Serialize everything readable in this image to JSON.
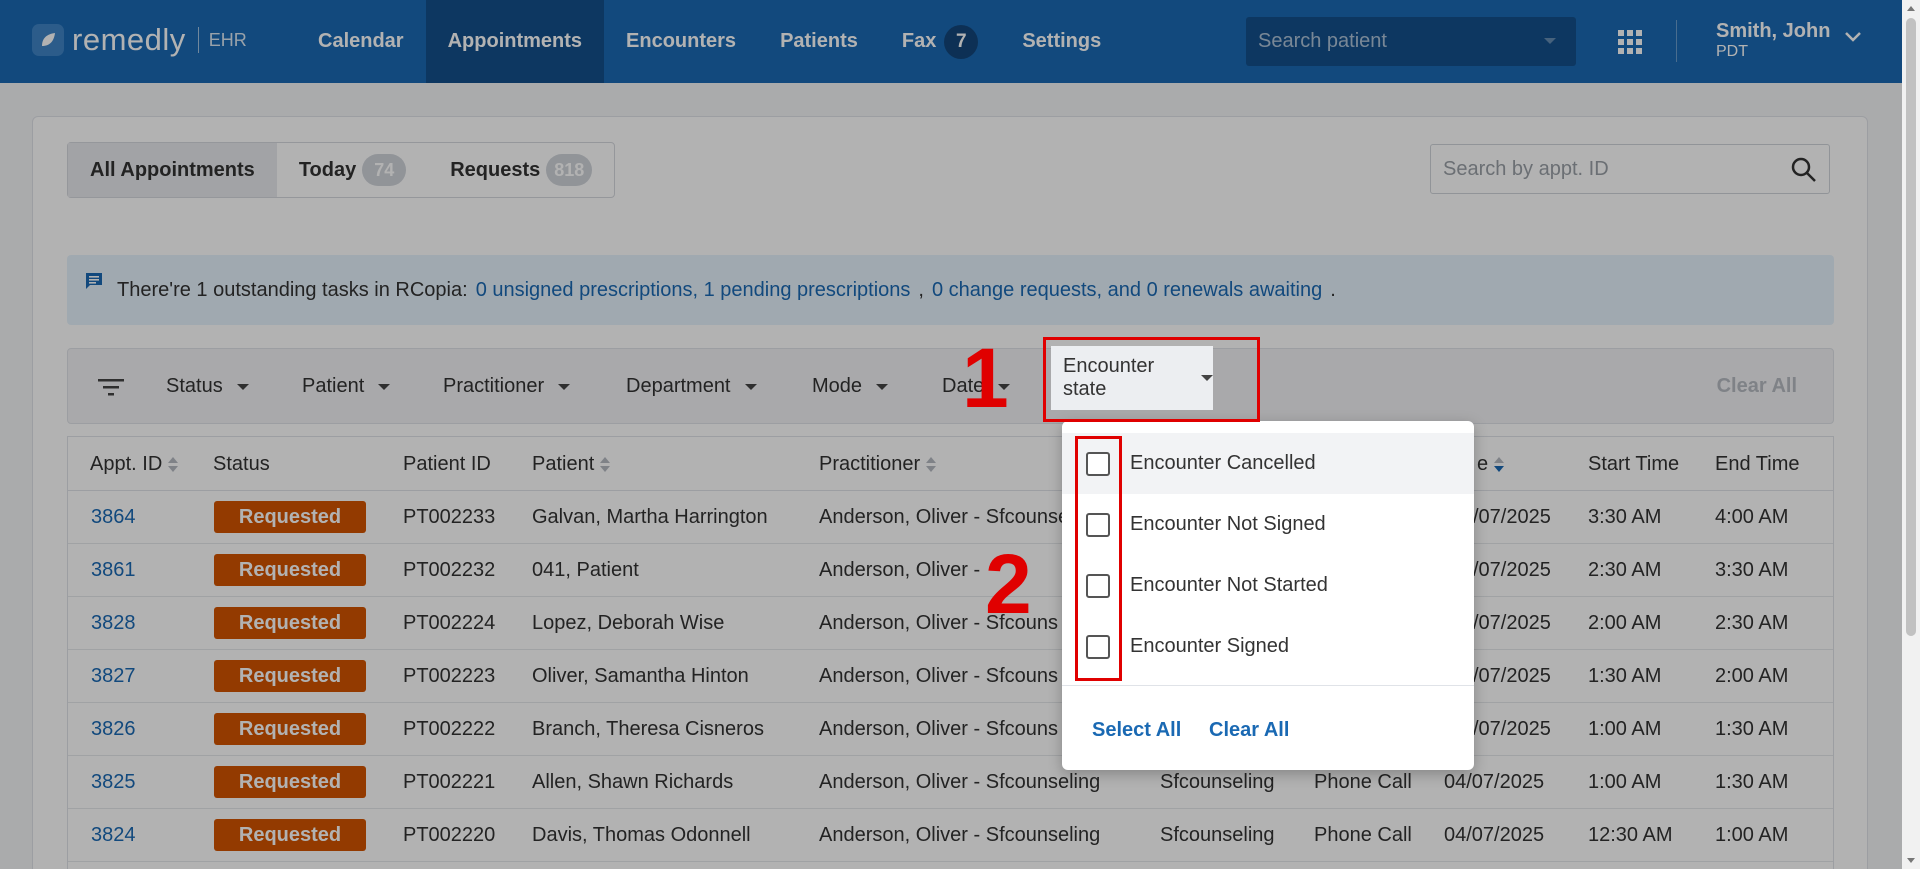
{
  "header": {
    "logo_text": "remedly",
    "logo_sub": "EHR",
    "nav": [
      {
        "label": "Calendar"
      },
      {
        "label": "Appointments"
      },
      {
        "label": "Encounters"
      },
      {
        "label": "Patients"
      },
      {
        "label": "Fax",
        "badge": "7"
      },
      {
        "label": "Settings"
      }
    ],
    "search_placeholder": "Search patient",
    "user_name": "Smith, John",
    "user_tz": "PDT"
  },
  "tabs": [
    {
      "label": "All Appointments"
    },
    {
      "label": "Today",
      "badge": "74"
    },
    {
      "label": "Requests",
      "badge": "818"
    }
  ],
  "appt_search_placeholder": "Search by appt. ID",
  "alert": {
    "text": "There're 1 outstanding tasks in RCopia:",
    "link1": "0 unsigned prescriptions, 1 pending prescriptions",
    "sep": ",",
    "link2": "0 change requests, and 0 renewals awaiting",
    "end": "."
  },
  "filters": {
    "status": "Status",
    "patient": "Patient",
    "practitioner": "Practitioner",
    "department": "Department",
    "mode": "Mode",
    "date": "Date",
    "encounter_state": "Encounter state",
    "clear_all": "Clear All"
  },
  "table": {
    "columns": [
      "Appt. ID",
      "Status",
      "Patient ID",
      "Patient",
      "Practitioner",
      "e",
      "Start Time",
      "End Time"
    ],
    "rows": [
      {
        "id": "3864",
        "status": "Requested",
        "pid": "PT002233",
        "patient": "Galvan, Martha Harrington",
        "practitioner": "Anderson, Oliver - Sfcounse",
        "dept": "",
        "mode": "",
        "date": "/07/2025",
        "start": "3:30 AM",
        "end": "4:00 AM"
      },
      {
        "id": "3861",
        "status": "Requested",
        "pid": "PT002232",
        "patient": "041, Patient",
        "practitioner": "Anderson, Oliver -",
        "dept": "",
        "mode": "",
        "date": "/07/2025",
        "start": "2:30 AM",
        "end": "3:30 AM"
      },
      {
        "id": "3828",
        "status": "Requested",
        "pid": "PT002224",
        "patient": "Lopez, Deborah Wise",
        "practitioner": "Anderson, Oliver - Sfcouns",
        "dept": "",
        "mode": "",
        "date": "/07/2025",
        "start": "2:00 AM",
        "end": "2:30 AM"
      },
      {
        "id": "3827",
        "status": "Requested",
        "pid": "PT002223",
        "patient": "Oliver, Samantha Hinton",
        "practitioner": "Anderson, Oliver - Sfcouns",
        "dept": "",
        "mode": "",
        "date": "/07/2025",
        "start": "1:30 AM",
        "end": "2:00 AM"
      },
      {
        "id": "3826",
        "status": "Requested",
        "pid": "PT002222",
        "patient": "Branch, Theresa Cisneros",
        "practitioner": "Anderson, Oliver - Sfcouns",
        "dept": "",
        "mode": "",
        "date": "/07/2025",
        "start": "1:00 AM",
        "end": "1:30 AM"
      },
      {
        "id": "3825",
        "status": "Requested",
        "pid": "PT002221",
        "patient": "Allen, Shawn Richards",
        "practitioner": "Anderson, Oliver - Sfcounseling",
        "dept": "Sfcounseling",
        "mode": "Phone Call",
        "date": "04/07/2025",
        "start": "1:00 AM",
        "end": "1:30 AM"
      },
      {
        "id": "3824",
        "status": "Requested",
        "pid": "PT002220",
        "patient": "Davis, Thomas Odonnell",
        "practitioner": "Anderson, Oliver - Sfcounseling",
        "dept": "Sfcounseling",
        "mode": "Phone Call",
        "date": "04/07/2025",
        "start": "12:30 AM",
        "end": "1:00 AM"
      }
    ]
  },
  "dropdown": {
    "items": [
      {
        "label": "Encounter Cancelled",
        "checked": false
      },
      {
        "label": "Encounter Not Signed",
        "checked": false
      },
      {
        "label": "Encounter Not Started",
        "checked": false
      },
      {
        "label": "Encounter Signed",
        "checked": false
      }
    ],
    "select_all": "Select All",
    "clear_all": "Clear All"
  },
  "annotations": {
    "one": "1",
    "two": "2"
  },
  "colors": {
    "brand": "#1a69b3",
    "status_requested": "#d35400",
    "annotation": "#e00000"
  }
}
